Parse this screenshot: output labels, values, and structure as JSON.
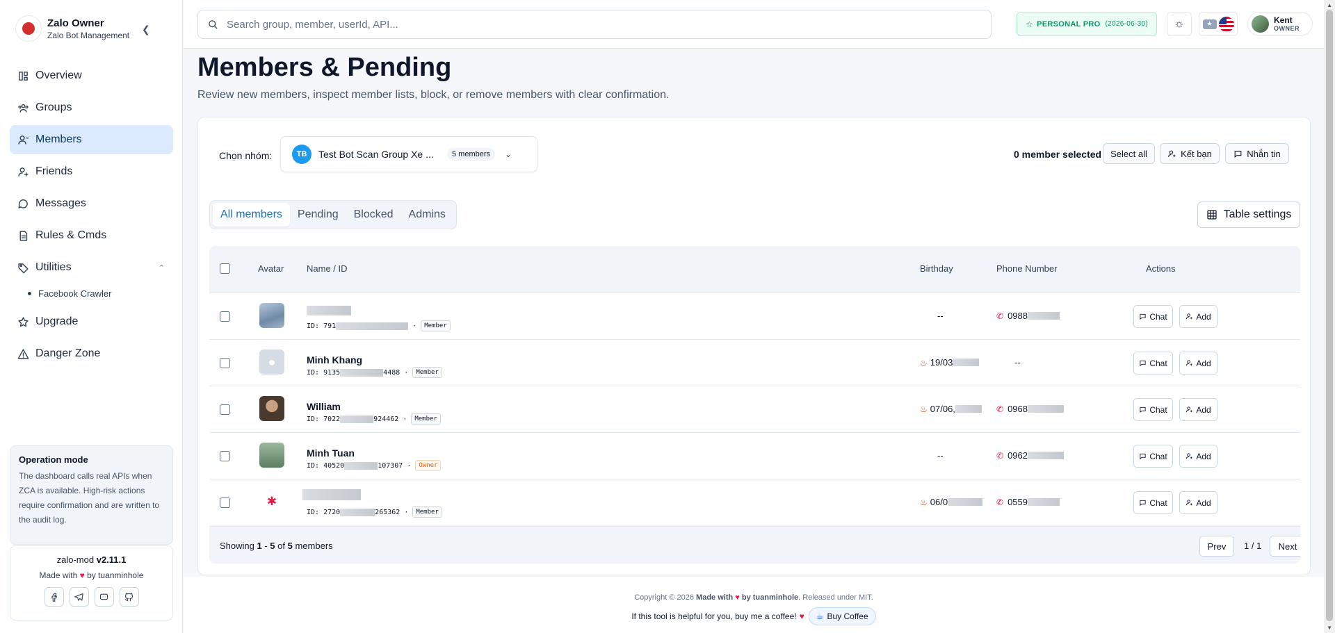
{
  "brand": {
    "title": "Zalo Owner",
    "subtitle": "Zalo Bot Management"
  },
  "sidebar": {
    "items": [
      {
        "label": "Overview",
        "icon": "layout-icon"
      },
      {
        "label": "Groups",
        "icon": "users-group-icon"
      },
      {
        "label": "Members",
        "icon": "user-icon",
        "active": true
      },
      {
        "label": "Friends",
        "icon": "user-plus-icon"
      },
      {
        "label": "Messages",
        "icon": "message-icon"
      },
      {
        "label": "Rules & Cmds",
        "icon": "file-icon"
      },
      {
        "label": "Utilities",
        "icon": "tag-icon",
        "expanded": true
      },
      {
        "label": "Upgrade",
        "icon": "star-icon"
      },
      {
        "label": "Danger Zone",
        "icon": "warning-icon"
      }
    ],
    "subitems": [
      {
        "label": "Facebook Crawler"
      }
    ],
    "operation": {
      "title": "Operation mode",
      "desc": "The dashboard calls real APIs when ZCA is available. High-risk actions require confirmation and are written to the audit log."
    },
    "version": {
      "name": "zalo-mod",
      "number": "v2.11.1",
      "made_prefix": "Made with",
      "made_suffix": "by tuanminhole"
    }
  },
  "topbar": {
    "search_placeholder": "Search group, member, userId, API...",
    "plan": "PERSONAL PRO",
    "plan_date": "(2026-06-30)",
    "user_name": "Kent",
    "user_role": "OWNER"
  },
  "page": {
    "title": "Members & Pending",
    "subtitle": "Review new members, inspect member lists, block, or remove members with clear confirmation."
  },
  "filter": {
    "group_label": "Chọn nhóm:",
    "group_badge": "TB",
    "group_name": "Test Bot Scan Group Xe ...",
    "group_count": "5 members",
    "selected": "0 member selected",
    "select_all": "Select all",
    "add_friend": "Kết bạn",
    "message": "Nhắn tin"
  },
  "tabs": [
    {
      "label": "All members",
      "active": true
    },
    {
      "label": "Pending"
    },
    {
      "label": "Blocked"
    },
    {
      "label": "Admins"
    }
  ],
  "table_settings": "Table settings",
  "table": {
    "headers": {
      "avatar": "Avatar",
      "name": "Name / ID",
      "birthday": "Birthday",
      "phone": "Phone Number",
      "actions": "Actions"
    },
    "rows": [
      {
        "name": "",
        "id_pre": "ID: 791",
        "id_post": "",
        "role": "Member",
        "birthday": "--",
        "phone": "0988",
        "avatar_color": "#8aa6c1"
      },
      {
        "name": "Minh Khang",
        "id_pre": "ID: 9135",
        "id_post": "4488",
        "role": "Member",
        "birthday": "19/03",
        "phone": "--",
        "avatar_color": "#cbd5e1"
      },
      {
        "name": "William",
        "id_pre": "ID: 7022",
        "id_post": "924462",
        "role": "Member",
        "birthday": "07/06,",
        "phone": "0968",
        "avatar_color": "#5b4636"
      },
      {
        "name": "Minh Tuan",
        "id_pre": "ID: 40520",
        "id_post": "107307",
        "role": "Owner",
        "birthday": "--",
        "phone": "0962",
        "avatar_color": "#7a9c7e"
      },
      {
        "name": "",
        "id_pre": "ID: 2720",
        "id_post": "265362",
        "role": "Member",
        "birthday": "06/0",
        "phone": "0559",
        "avatar_color": "#ffffff"
      }
    ],
    "chat": "Chat",
    "add": "Add"
  },
  "pagination": {
    "showing_prefix": "Showing",
    "from": "1",
    "to": "5",
    "total": "5",
    "unit": "members",
    "prev": "Prev",
    "page": "1 / 1",
    "next": "Next"
  },
  "footer": {
    "copyright_prefix": "Copyright © 2026",
    "made": "Made with",
    "by": "by tuanminhole",
    "license": "Released under MIT.",
    "coffee_text": "If this tool is helpful for you, buy me a coffee!",
    "coffee_button": "Buy Coffee"
  }
}
